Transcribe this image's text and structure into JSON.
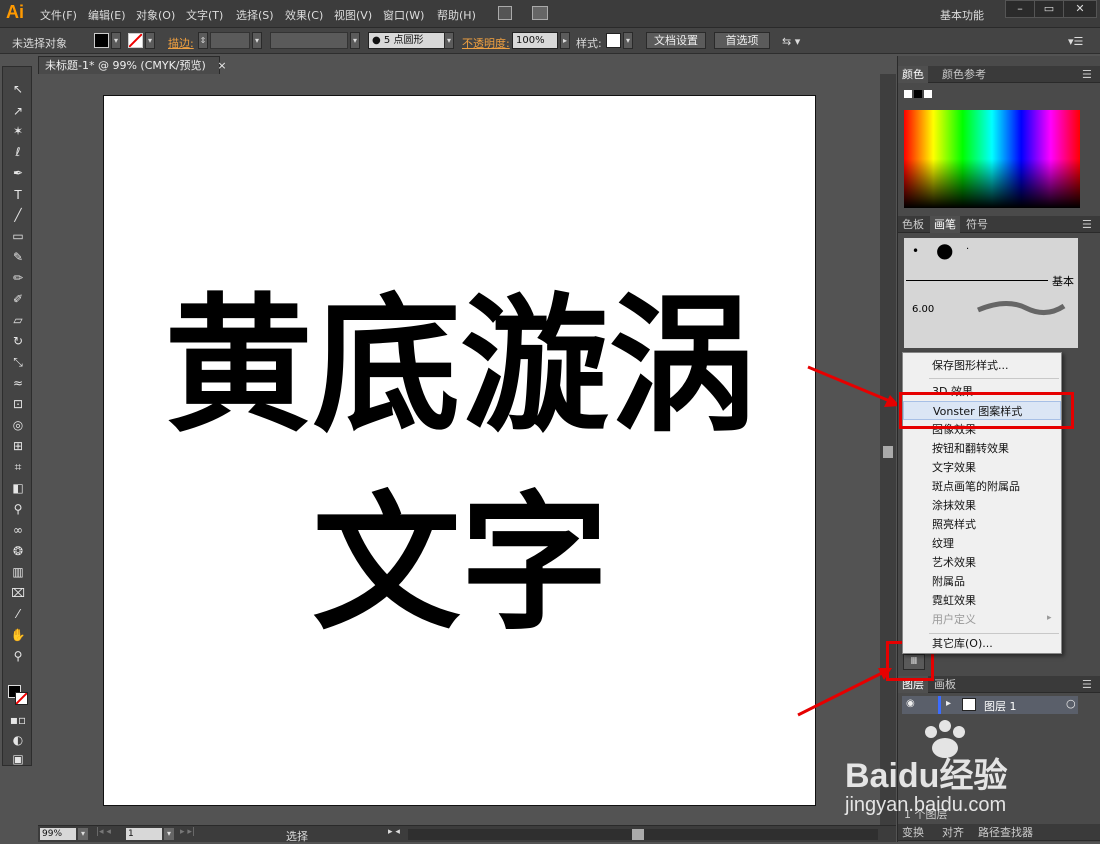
{
  "app": {
    "logo": "Ai",
    "menus": [
      "文件(F)",
      "编辑(E)",
      "对象(O)",
      "文字(T)",
      "选择(S)",
      "效果(C)",
      "视图(V)",
      "窗口(W)",
      "帮助(H)"
    ],
    "workspace": "基本功能",
    "window_buttons": [
      "–",
      "▭",
      "✕"
    ]
  },
  "controlbar": {
    "selection_label": "未选择对象",
    "stroke_label": "描边:",
    "brush_value": "5 点圆形",
    "opacity_label": "不透明度:",
    "opacity_value": "100%",
    "style_label": "样式:",
    "doc_settings_button": "文档设置",
    "preferences_button": "首选项"
  },
  "document": {
    "tab_title": "未标题-1* @ 99% (CMYK/预览)",
    "close": "×",
    "line1": "黄底漩涡",
    "line2": "文字"
  },
  "statusbar": {
    "zoom": "99%",
    "page": "1",
    "status_text": "选择"
  },
  "panels": {
    "color_tabs": [
      "颜色",
      "颜色参考"
    ],
    "swatch_tabs": [
      "色板",
      "画笔",
      "符号"
    ],
    "brush_basic": "基本",
    "brush_size": "6.00",
    "layers_tabs": [
      "图层",
      "画板"
    ],
    "layer_name": "图层 1",
    "layers_count": "1 个图层",
    "bottom_tabs": [
      "变换",
      "对齐",
      "路径查找器"
    ]
  },
  "flyout_menu": {
    "items": [
      {
        "label": "保存图形样式...",
        "disabled": false
      },
      {
        "label": "3D 效果",
        "disabled": false
      },
      {
        "label": "Vonster 图案样式",
        "disabled": false
      },
      {
        "label": "图像效果",
        "disabled": false
      },
      {
        "label": "按钮和翻转效果",
        "disabled": false
      },
      {
        "label": "文字效果",
        "disabled": false
      },
      {
        "label": "斑点画笔的附属品",
        "disabled": false
      },
      {
        "label": "涂抹效果",
        "disabled": false
      },
      {
        "label": "照亮样式",
        "disabled": false
      },
      {
        "label": "纹理",
        "disabled": false
      },
      {
        "label": "艺术效果",
        "disabled": false
      },
      {
        "label": "附属品",
        "disabled": false
      },
      {
        "label": "霓虹效果",
        "disabled": false
      },
      {
        "label": "用户定义",
        "disabled": true
      },
      {
        "label": "其它库(O)...",
        "disabled": false
      }
    ],
    "highlighted_index": 2
  },
  "watermark": {
    "brand": "Baidu经验",
    "url": "jingyan.baidu.com"
  },
  "colors": {
    "accent_red": "#e60000",
    "ai_orange": "#ff9a00"
  }
}
